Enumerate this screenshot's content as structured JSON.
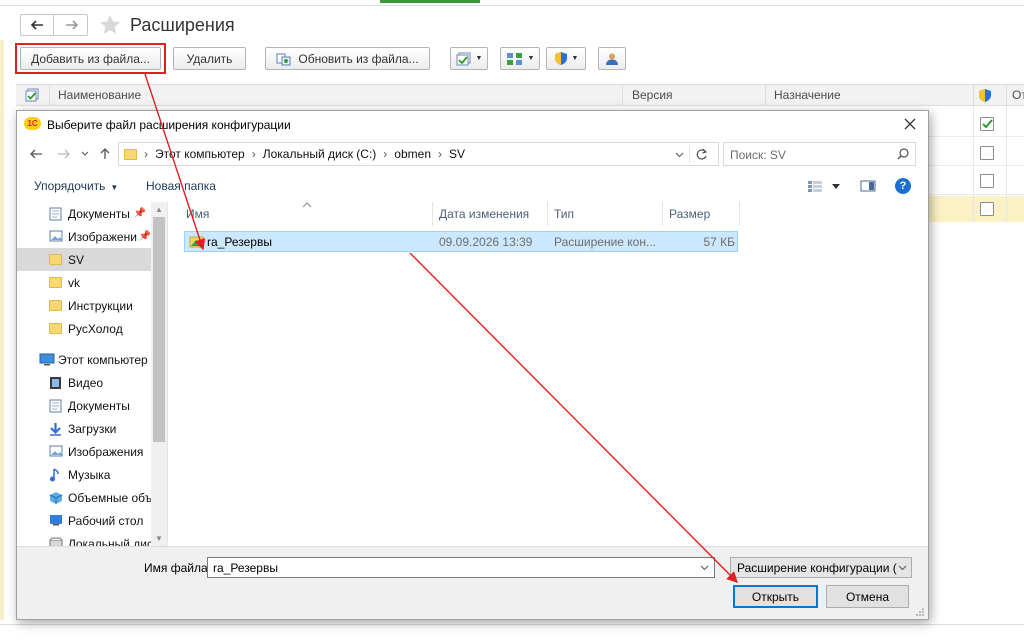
{
  "app": {
    "title": "Расширения",
    "toolbar": {
      "add_from_file": "Добавить из файла...",
      "delete": "Удалить",
      "update_from_file": "Обновить из файла..."
    },
    "grid": {
      "columns": [
        "Наименование",
        "Версия",
        "Назначение",
        "От"
      ]
    },
    "rows": [
      {
        "checked": true
      },
      {
        "checked": false
      },
      {
        "checked": false
      },
      {
        "checked": false
      }
    ]
  },
  "dialog": {
    "title": "Выберите файл расширения конфигурации",
    "address": [
      "Этот компьютер",
      "Локальный диск (C:)",
      "obmen",
      "SV"
    ],
    "search_placeholder": "Поиск: SV",
    "commands": {
      "organize": "Упорядочить",
      "new_folder": "Новая папка"
    },
    "nav": {
      "quick": [
        {
          "label": "Документы",
          "icon": "documents-icon",
          "pinned": true
        },
        {
          "label": "Изображени",
          "icon": "pictures-icon",
          "pinned": true
        },
        {
          "label": "SV",
          "icon": "folder-icon",
          "selected": true
        },
        {
          "label": "vk",
          "icon": "folder-icon"
        },
        {
          "label": "Инструкции",
          "icon": "folder-icon"
        },
        {
          "label": "РусХолод",
          "icon": "folder-icon"
        }
      ],
      "this_pc": "Этот компьютер",
      "pc_items": [
        {
          "label": "Видео",
          "icon": "video-icon"
        },
        {
          "label": "Документы",
          "icon": "documents-icon"
        },
        {
          "label": "Загрузки",
          "icon": "downloads-icon"
        },
        {
          "label": "Изображения",
          "icon": "pictures-icon"
        },
        {
          "label": "Музыка",
          "icon": "music-icon"
        },
        {
          "label": "Объемные объ",
          "icon": "3d-objects-icon"
        },
        {
          "label": "Рабочий стол",
          "icon": "desktop-icon"
        },
        {
          "label": "Локальный дис",
          "icon": "drive-icon"
        }
      ]
    },
    "columns": {
      "name": "Имя",
      "date": "Дата изменения",
      "type": "Тип",
      "size": "Размер"
    },
    "files": [
      {
        "name": "ra_Резервы",
        "date": "09.09.2026 13:39",
        "type": "Расширение кон...",
        "size": "57 КБ"
      }
    ],
    "filename_label": "Имя файла:",
    "filename_value": "ra_Резервы",
    "filter": "Расширение конфигурации (*",
    "open": "Открыть",
    "cancel": "Отмена"
  },
  "colors": {
    "annotation": "#e02020",
    "selection": "#cce8ff",
    "accent": "#0078d7"
  }
}
